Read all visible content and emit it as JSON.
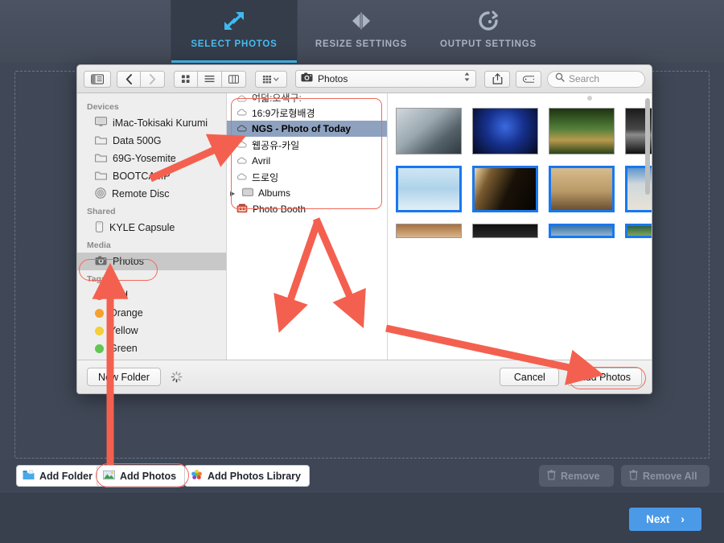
{
  "app": {
    "tabs": [
      {
        "label": "SELECT PHOTOS",
        "icon": "resize-arrows-icon",
        "active": true
      },
      {
        "label": "RESIZE SETTINGS",
        "icon": "mirror-triangles-icon",
        "active": false
      },
      {
        "label": "OUTPUT SETTINGS",
        "icon": "refresh-circle-icon",
        "active": false
      }
    ],
    "accent_color": "#45bdf0",
    "body_color": "#404857",
    "toolbar": {
      "add_folder": "Add Folder",
      "add_photos": "Add Photos",
      "add_photos_library": "Add Photos Library",
      "remove": "Remove",
      "remove_all": "Remove All"
    },
    "footer": {
      "next": "Next",
      "next_chevron": "›",
      "next_color": "#4a9ae8"
    }
  },
  "dialog": {
    "toolbar": {
      "sidebar_toggle_icon": "sidebar-toggle-icon",
      "back_icon": "chevron-left-icon",
      "forward_icon": "chevron-right-icon",
      "view_icon_grid": "grid-view-icon",
      "view_icon_list": "list-view-icon",
      "view_icon_column": "column-view-icon",
      "arrange_icon": "arrange-by-icon",
      "path_icon": "camera-icon",
      "path_label": "Photos",
      "share_icon": "share-icon",
      "tag_icon": "tag-icon",
      "search_icon": "search-icon",
      "search_placeholder": "Search"
    },
    "sidebar": {
      "sections": [
        {
          "title": "Devices",
          "items": [
            {
              "label": "iMac-Tokisaki Kurumi",
              "icon": "imac-icon",
              "selected": false
            },
            {
              "label": "Data 500G",
              "icon": "folder-icon",
              "selected": false
            },
            {
              "label": "69G-Yosemite",
              "icon": "folder-icon",
              "selected": false
            },
            {
              "label": "BOOTCAMP",
              "icon": "folder-icon",
              "selected": false
            },
            {
              "label": "Remote Disc",
              "icon": "disc-icon",
              "selected": false
            }
          ]
        },
        {
          "title": "Shared",
          "items": [
            {
              "label": "KYLE Capsule",
              "icon": "timecapsule-icon",
              "selected": false
            }
          ]
        },
        {
          "title": "Media",
          "items": [
            {
              "label": "Photos",
              "icon": "camera-icon",
              "selected": true
            }
          ]
        },
        {
          "title": "Tags",
          "items": [
            {
              "label": "Red",
              "icon": "tag-dot-icon",
              "color": "#fa5a52",
              "selected": false
            },
            {
              "label": "Orange",
              "icon": "tag-dot-icon",
              "color": "#f8a02c",
              "selected": false
            },
            {
              "label": "Yellow",
              "icon": "tag-dot-icon",
              "color": "#f5ce3a",
              "selected": false
            },
            {
              "label": "Green",
              "icon": "tag-dot-icon",
              "color": "#63c552",
              "selected": false
            }
          ]
        }
      ]
    },
    "column_list": {
      "items": [
        {
          "label": "여덟:오색구:",
          "icon": "cloud-icon",
          "selected": false,
          "clipped": true
        },
        {
          "label": "16:9가로형배경",
          "icon": "cloud-icon",
          "selected": false
        },
        {
          "label": "NGS - Photo of Today",
          "icon": "cloud-icon",
          "selected": true
        },
        {
          "label": "웹공유-카일",
          "icon": "cloud-icon",
          "selected": false
        },
        {
          "label": "Avril",
          "icon": "cloud-icon",
          "selected": false
        },
        {
          "label": "드로잉",
          "icon": "cloud-icon",
          "selected": false
        },
        {
          "label": "Albums",
          "icon": "albums-icon",
          "selected": false,
          "disclosure": "▶"
        },
        {
          "label": "Photo Booth",
          "icon": "photobooth-icon",
          "selected": false
        }
      ]
    },
    "grid": {
      "rows": [
        [
          {
            "name": "thumb-seaside-portrait",
            "selected": false,
            "c1": "#b8c3c9",
            "c2": "#6e7a80",
            "c3": "#3f4a52"
          },
          {
            "name": "thumb-blue-interior",
            "selected": false,
            "c1": "#0b1a4a",
            "c2": "#1d3fa8",
            "c3": "#060d22"
          },
          {
            "name": "thumb-green-cave",
            "selected": false,
            "c1": "#2c4a1c",
            "c2": "#7da24c",
            "c3": "#16260e"
          },
          {
            "name": "thumb-bw-landscape",
            "selected": false,
            "c1": "#1a1a1a",
            "c2": "#6a6a6a",
            "c3": "#0a0a0a"
          },
          {
            "name": "thumb-market-stall",
            "selected": false,
            "c1": "#4a3a16",
            "c2": "#9a7a30",
            "c3": "#241a08"
          }
        ],
        [
          {
            "name": "thumb-floating-island",
            "selected": true,
            "c1": "#b8dcf0",
            "c2": "#4c8a3c",
            "c3": "#dce9f2"
          },
          {
            "name": "thumb-light-rays",
            "selected": true,
            "c1": "#120d08",
            "c2": "#e8c890",
            "c3": "#060402"
          },
          {
            "name": "thumb-dancers",
            "selected": true,
            "c1": "#c2a070",
            "c2": "#3a2a18",
            "c3": "#e0c898"
          },
          {
            "name": "thumb-ice-cliff",
            "selected": true,
            "c1": "#5c92c8",
            "c2": "#e4ddd2",
            "c3": "#b8c8d8"
          },
          {
            "name": "thumb-desert-horse",
            "selected": false,
            "c1": "#6fa8d8",
            "c2": "#c89a62",
            "c3": "#a87c48"
          }
        ],
        [
          {
            "name": "thumb-partial-1",
            "selected": false,
            "c1": "#8a5a36",
            "c2": "#d8b890",
            "c3": "#3a2414"
          },
          {
            "name": "thumb-partial-2",
            "selected": false,
            "c1": "#0a0a0a",
            "c2": "#2a2a2a",
            "c3": "#000000"
          },
          {
            "name": "thumb-partial-3",
            "selected": true,
            "c1": "#3a6a9a",
            "c2": "#8ab0d0",
            "c3": "#1a3a5a"
          },
          {
            "name": "thumb-partial-4",
            "selected": true,
            "c1": "#2a5a3a",
            "c2": "#7aa05a",
            "c3": "#10300e"
          },
          {
            "name": "thumb-partial-5",
            "selected": true,
            "c1": "#5a3a6a",
            "c2": "#a07ac0",
            "c3": "#2a1636"
          }
        ]
      ]
    },
    "footer": {
      "new_folder": "New Folder",
      "spinner_icon": "loading-spinner-icon",
      "cancel": "Cancel",
      "add_photos": "Add Photos"
    }
  },
  "annotations": {
    "highlight_color": "#f2695c",
    "arrow_color": "#f4604f",
    "highlighted": [
      "sidebar-item-photos",
      "column-list-panel",
      "dialog-add-photos-button",
      "toolbar-add-photos-button"
    ]
  }
}
